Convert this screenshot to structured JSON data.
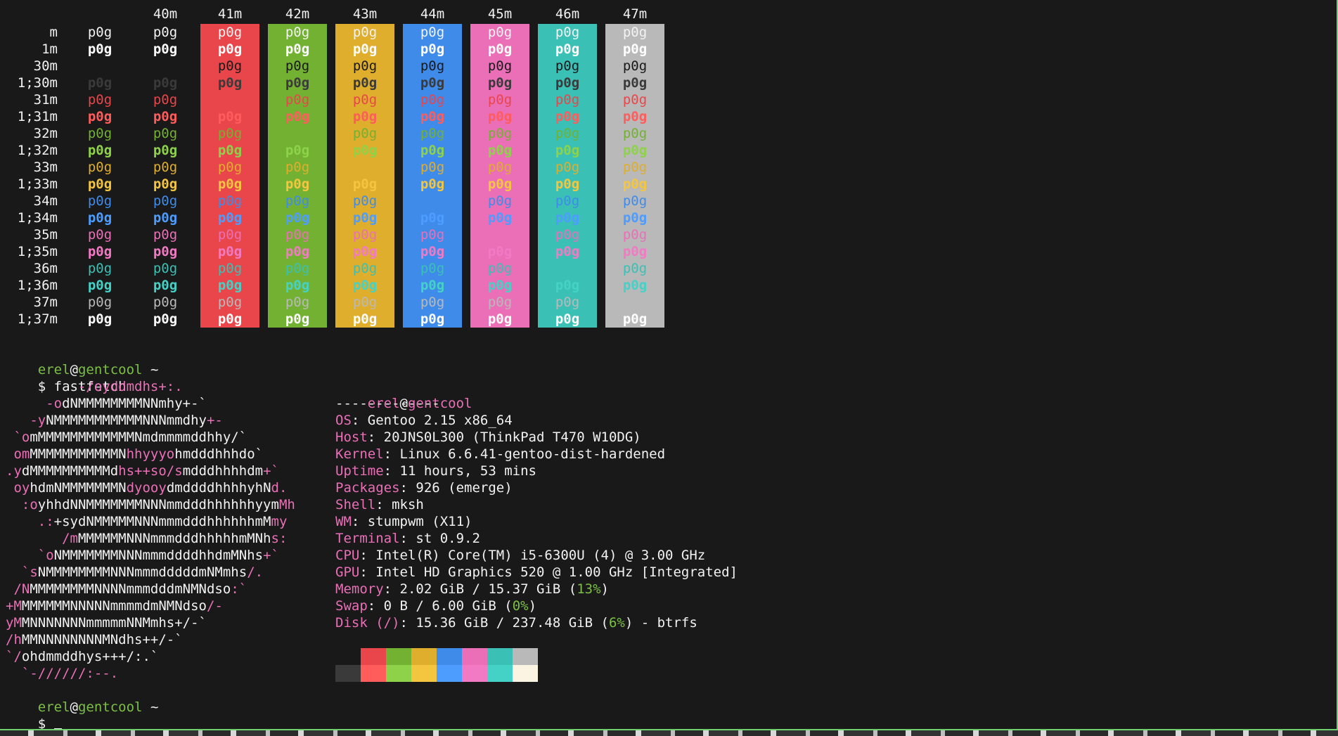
{
  "color_test": {
    "headers": [
      "40m",
      "41m",
      "42m",
      "43m",
      "44m",
      "45m",
      "46m",
      "47m"
    ],
    "bg_colors": [
      "#e8464a",
      "#73b132",
      "#dfae2c",
      "#3f8bea",
      "#ea6fb7",
      "#3bc0b5",
      "#b9b9b9"
    ],
    "sample": "p0g",
    "rows": [
      {
        "label": "m",
        "fg": "#f2f2f2",
        "bold": false
      },
      {
        "label": "1m",
        "fg": "#ffffff",
        "bold": true
      },
      {
        "label": "30m",
        "fg": "#191919",
        "bold": false
      },
      {
        "label": "1;30m",
        "fg": "#3a3a3a",
        "bold": true
      },
      {
        "label": "31m",
        "fg": "#e8464a",
        "bold": false
      },
      {
        "label": "1;31m",
        "fg": "#ff5c5c",
        "bold": true
      },
      {
        "label": "32m",
        "fg": "#73b132",
        "bold": false
      },
      {
        "label": "1;32m",
        "fg": "#8ed24a",
        "bold": true
      },
      {
        "label": "33m",
        "fg": "#dfae2c",
        "bold": false
      },
      {
        "label": "1;33m",
        "fg": "#f4c640",
        "bold": true
      },
      {
        "label": "34m",
        "fg": "#3f8bea",
        "bold": false
      },
      {
        "label": "1;34m",
        "fg": "#4d9cff",
        "bold": true
      },
      {
        "label": "35m",
        "fg": "#ea6fb7",
        "bold": false
      },
      {
        "label": "1;35m",
        "fg": "#f27ac4",
        "bold": true
      },
      {
        "label": "36m",
        "fg": "#3bc0b5",
        "bold": false
      },
      {
        "label": "1;36m",
        "fg": "#45d2c6",
        "bold": true
      },
      {
        "label": "37m",
        "fg": "#b9b9b9",
        "bold": false
      },
      {
        "label": "1;37m",
        "fg": "#ffffff",
        "bold": true
      }
    ]
  },
  "prompt": {
    "user": "erel",
    "at": "@",
    "host": "gentcool",
    "dir": "~",
    "symbol": "$",
    "command": "fastfetch"
  },
  "logo_lines": [
    [
      [
        "         ",
        "#ea6fb7"
      ],
      [
        "-/oyddmdhs+:.",
        "#ea6fb7"
      ]
    ],
    [
      [
        "     -o",
        "#ea6fb7"
      ],
      [
        "dNMMMMMMMMNNmhy+-`",
        "#f2f2f2"
      ]
    ],
    [
      [
        "   -y",
        "#ea6fb7"
      ],
      [
        "NMMMMMMMMMMMNNNmmdhy",
        "#f2f2f2"
      ],
      [
        "+-",
        "#ea6fb7"
      ]
    ],
    [
      [
        " `o",
        "#ea6fb7"
      ],
      [
        "mMMMMMMMMMMMMNmdmmmmddhhy/`",
        "#f2f2f2"
      ]
    ],
    [
      [
        " om",
        "#ea6fb7"
      ],
      [
        "MMMMMMMMMMMN",
        "#f2f2f2"
      ],
      [
        "hhyyyo",
        "#ea6fb7"
      ],
      [
        "hmdddhhhdo`",
        "#f2f2f2"
      ]
    ],
    [
      [
        ".y",
        "#ea6fb7"
      ],
      [
        "dMMMMMMMMMMd",
        "#f2f2f2"
      ],
      [
        "hs++so/s",
        "#ea6fb7"
      ],
      [
        "mdddhhhhdm",
        "#f2f2f2"
      ],
      [
        "+`",
        "#ea6fb7"
      ]
    ],
    [
      [
        " oy",
        "#ea6fb7"
      ],
      [
        "hdmNMMMMMMMN",
        "#f2f2f2"
      ],
      [
        "dyooy",
        "#ea6fb7"
      ],
      [
        "dmddddhhhhyhN",
        "#f2f2f2"
      ],
      [
        "d.",
        "#ea6fb7"
      ]
    ],
    [
      [
        "  :o",
        "#ea6fb7"
      ],
      [
        "yhhdNNMMMMMMMNNNmmdddhhhhhhyym",
        "#f2f2f2"
      ],
      [
        "Mh",
        "#ea6fb7"
      ]
    ],
    [
      [
        "    .:",
        "#ea6fb7"
      ],
      [
        "+sydNMMMMMNNNmmmdddhhhhhhmM",
        "#f2f2f2"
      ],
      [
        "my",
        "#ea6fb7"
      ]
    ],
    [
      [
        "       /m",
        "#ea6fb7"
      ],
      [
        "MMMMMMNNNmmmdddhhhhhmMNh",
        "#f2f2f2"
      ],
      [
        "s:",
        "#ea6fb7"
      ]
    ],
    [
      [
        "    `o",
        "#ea6fb7"
      ],
      [
        "NMMMMMMMNNNmmmddddhhdmMNhs",
        "#f2f2f2"
      ],
      [
        "+`",
        "#ea6fb7"
      ]
    ],
    [
      [
        "  `s",
        "#ea6fb7"
      ],
      [
        "NMMMMMMMMNNNmmmdddddmNMmhs",
        "#f2f2f2"
      ],
      [
        "/.",
        "#ea6fb7"
      ]
    ],
    [
      [
        " /N",
        "#ea6fb7"
      ],
      [
        "MMMMMMMMNNNNmmmdddmNMNdso",
        "#f2f2f2"
      ],
      [
        ":`",
        "#ea6fb7"
      ]
    ],
    [
      [
        "+M",
        "#ea6fb7"
      ],
      [
        "MMMMMMNNNNNmmmmdmNMNdso",
        "#f2f2f2"
      ],
      [
        "/-",
        "#ea6fb7"
      ]
    ],
    [
      [
        "yM",
        "#ea6fb7"
      ],
      [
        "MNNNNNNNmmmmmNNMmhs+/-`",
        "#f2f2f2"
      ]
    ],
    [
      [
        "/h",
        "#ea6fb7"
      ],
      [
        "MMNNNNNNNNMNdhs++/-`",
        "#f2f2f2"
      ]
    ],
    [
      [
        "`/",
        "#ea6fb7"
      ],
      [
        "ohdmmddhys+++/:.`",
        "#f2f2f2"
      ]
    ],
    [
      [
        "  `-//////:--.",
        "#ea6fb7"
      ]
    ]
  ],
  "info": {
    "title_user": "erel",
    "title_at": "@",
    "title_host": "gentcool",
    "separator": "-------------",
    "lines": [
      {
        "key": "OS",
        "value": "Gentoo 2.15 x86_64"
      },
      {
        "key": "Host",
        "value": "20JNS0L300 (ThinkPad T470 W10DG)"
      },
      {
        "key": "Kernel",
        "value": "Linux 6.6.41-gentoo-dist-hardened"
      },
      {
        "key": "Uptime",
        "value": "11 hours, 53 mins"
      },
      {
        "key": "Packages",
        "value": "926 (emerge)"
      },
      {
        "key": "Shell",
        "value": "mksh"
      },
      {
        "key": "WM",
        "value": "stumpwm (X11)"
      },
      {
        "key": "Terminal",
        "value": "st 0.9.2"
      },
      {
        "key": "CPU",
        "value": "Intel(R) Core(TM) i5-6300U (4) @ 3.00 GHz"
      },
      {
        "key": "GPU",
        "value": "Intel HD Graphics 520 @ 1.00 GHz [Integrated]"
      },
      {
        "key": "Memory",
        "value": "2.02 GiB / 15.37 GiB (",
        "pct": "13%",
        "tail": ")"
      },
      {
        "key": "Swap",
        "value": "0 B / 6.00 GiB (",
        "pct": "0%",
        "tail": ")"
      },
      {
        "key": "Disk (/)",
        "value": "15.36 GiB / 237.48 GiB (",
        "pct": "6%",
        "tail": ") - btrfs"
      }
    ],
    "palette_top": [
      "#191919",
      "#e8464a",
      "#73b132",
      "#dfae2c",
      "#3f8bea",
      "#ea6fb7",
      "#3bc0b5",
      "#b9b9b9"
    ],
    "palette_bottom": [
      "#3a3a3a",
      "#ff5c5c",
      "#8ed24a",
      "#f4c640",
      "#4d9cff",
      "#f27ac4",
      "#45d2c6",
      "#fbf4e2"
    ]
  }
}
